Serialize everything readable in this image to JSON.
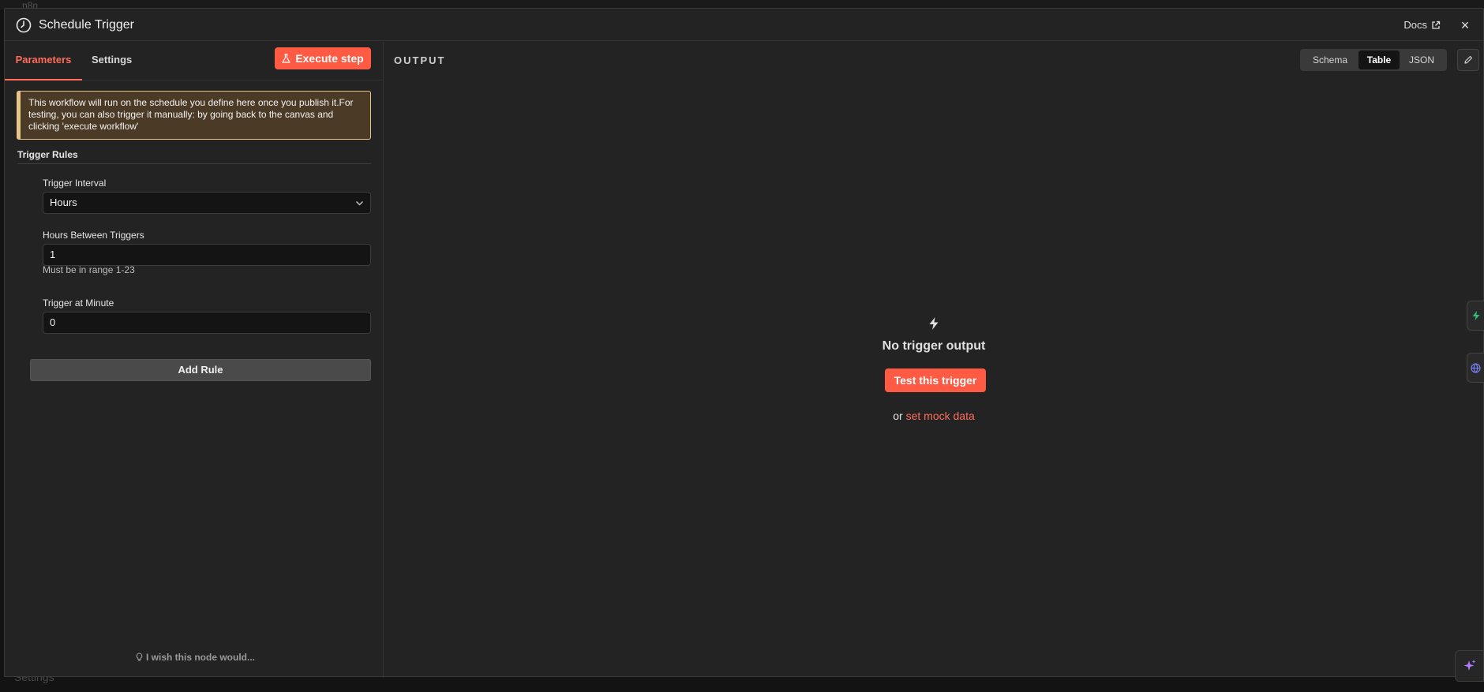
{
  "background": {
    "app_name": "n8n",
    "sidebar_settings_label": "Settings"
  },
  "modal": {
    "title": "Schedule Trigger",
    "docs_label": "Docs",
    "close_glyph": "×"
  },
  "left": {
    "tabs": {
      "parameters": "Parameters",
      "settings": "Settings"
    },
    "execute_label": "Execute step",
    "notice": "This workflow will run on the schedule you define here once you publish it.For testing, you can also trigger it manually: by going back to the canvas and clicking 'execute workflow'",
    "section_title": "Trigger Rules",
    "trigger_interval": {
      "label": "Trigger Interval",
      "value": "Hours"
    },
    "hours_between": {
      "label": "Hours Between Triggers",
      "value": "1",
      "hint": "Must be in range 1-23"
    },
    "trigger_minute": {
      "label": "Trigger at Minute",
      "value": "0"
    },
    "add_rule_label": "Add Rule",
    "wish_label": "I wish this node would..."
  },
  "output": {
    "label": "OUTPUT",
    "views": {
      "schema": "Schema",
      "table": "Table",
      "json": "JSON"
    },
    "active_view": "Table",
    "empty_title": "No trigger output",
    "test_button": "Test this trigger",
    "mock_prefix": "or",
    "mock_link": "set mock data"
  },
  "colors": {
    "accent": "#ff5a44",
    "accent_text": "#ff6d5a",
    "notice_border": "#e8c588",
    "panel": "#232323"
  },
  "icons": {
    "header": "clock-icon",
    "docs": "external-link-icon",
    "execute": "flask-icon",
    "empty": "lightning-icon",
    "wish": "lightbulb-icon",
    "edit": "pencil-icon",
    "ai": "sparkle-icon"
  }
}
